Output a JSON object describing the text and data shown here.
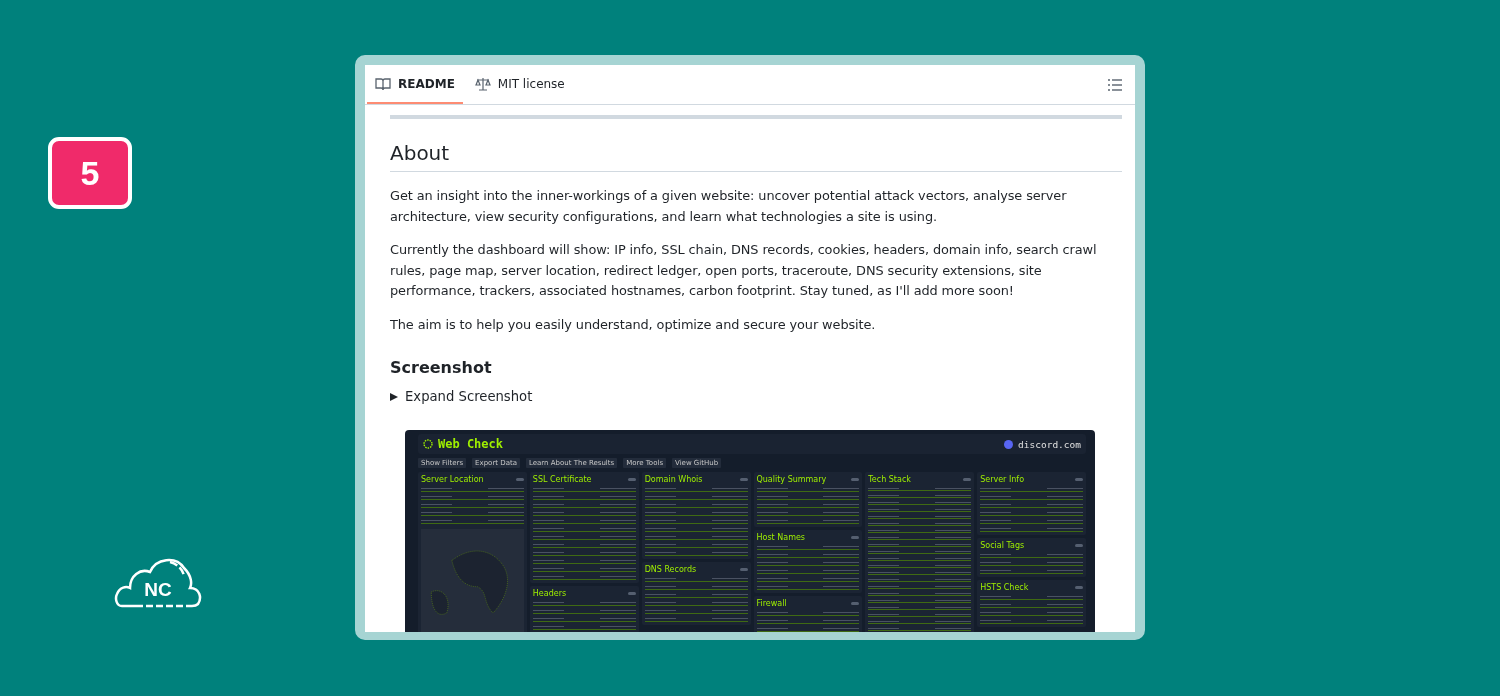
{
  "badge": "5",
  "logo_text": "NC",
  "tabs": [
    {
      "label": "README",
      "selected": true
    },
    {
      "label": "MIT license",
      "selected": false
    }
  ],
  "about": {
    "heading": "About",
    "paragraphs": [
      "Get an insight into the inner-workings of a given website: uncover potential attack vectors, analyse server architecture, view security configurations, and learn what technologies a site is using.",
      "Currently the dashboard will show: IP info, SSL chain, DNS records, cookies, headers, domain info, search crawl rules, page map, server location, redirect ledger, open ports, traceroute, DNS security extensions, site performance, trackers, associated hostnames, carbon footprint. Stay tuned, as I'll add more soon!",
      "The aim is to help you easily understand, optimize and secure your website."
    ]
  },
  "screenshot": {
    "heading": "Screenshot",
    "toggle": "Expand Screenshot",
    "expanded": false,
    "dashboard": {
      "title": "Web Check",
      "site": "discord.com",
      "toolbar": [
        "Show Filters",
        "Export Data",
        "Learn About The Results",
        "More Tools",
        "View GitHub"
      ],
      "columns": [
        [
          {
            "title": "Server Location",
            "kind": "map"
          }
        ],
        [
          {
            "title": "SSL Certificate",
            "kind": "table"
          },
          {
            "title": "Headers",
            "kind": "table"
          }
        ],
        [
          {
            "title": "Domain Whois",
            "kind": "table"
          },
          {
            "title": "DNS Records",
            "kind": "table"
          }
        ],
        [
          {
            "title": "Quality Summary",
            "kind": "table"
          },
          {
            "title": "Host Names",
            "kind": "table"
          },
          {
            "title": "Firewall",
            "kind": "table"
          }
        ],
        [
          {
            "title": "Tech Stack",
            "kind": "list"
          }
        ],
        [
          {
            "title": "Server Info",
            "kind": "table"
          },
          {
            "title": "Social Tags",
            "kind": "table"
          },
          {
            "title": "HSTS Check",
            "kind": "table"
          }
        ]
      ]
    }
  }
}
